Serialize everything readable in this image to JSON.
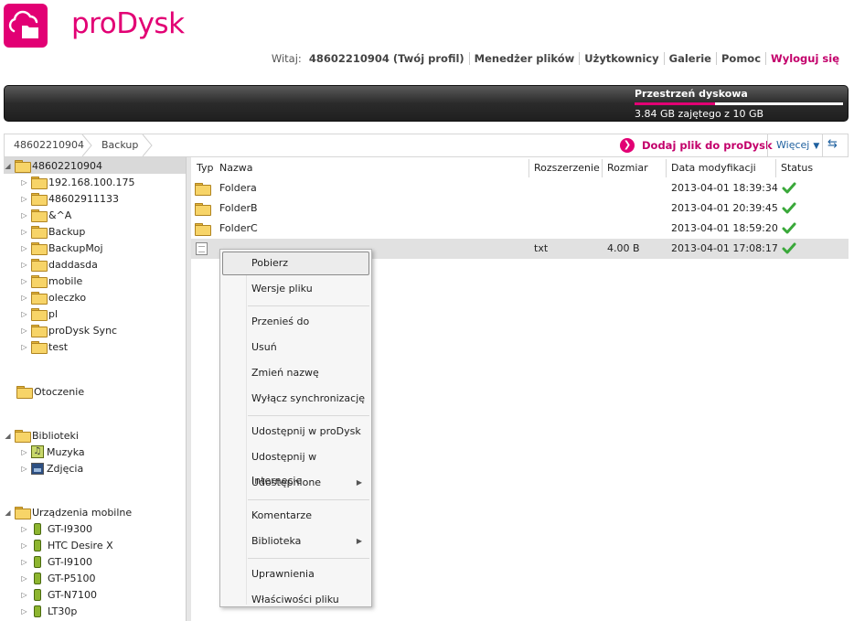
{
  "header": {
    "app_title": "proDysk",
    "welcome_label": "Witaj:",
    "user": "48602210904 (Twój profil)",
    "nav": [
      "Menedżer plików",
      "Użytkownicy",
      "Galerie",
      "Pomoc"
    ],
    "logout": "Wyloguj się"
  },
  "storage": {
    "label": "Przestrzeń dyskowa",
    "usage_text": "3.84 GB zajętego z 10 GB",
    "used_fraction": 0.384
  },
  "breadcrumb": [
    "48602210904",
    "Backup"
  ],
  "toolbar": {
    "add_file": "Dodaj plik do proDysk",
    "more": "Więcej"
  },
  "sidebar": {
    "root": "48602210904",
    "folders": [
      "192.168.100.175",
      "48602911133",
      "&^A",
      "Backup",
      "BackupMoj",
      "daddasda",
      "mobile",
      "oleczko",
      "pl",
      "proDysk Sync",
      "test"
    ],
    "environment": "Otoczenie",
    "libraries": {
      "label": "Biblioteki",
      "items": [
        "Muzyka",
        "Zdjęcia"
      ]
    },
    "mobile": {
      "label": "Urządzenia mobilne",
      "items": [
        "GT-I9300",
        "HTC Desire X",
        "GT-I9100",
        "GT-P5100",
        "GT-N7100",
        "LT30p"
      ]
    }
  },
  "columns": {
    "type": "Typ",
    "name": "Nazwa",
    "ext": "Rozszerzenie",
    "size": "Rozmiar",
    "modified": "Data modyfikacji",
    "status": "Status"
  },
  "files": [
    {
      "name": "Foldera",
      "ext": "",
      "size": "",
      "modified": "2013-04-01 18:39:34"
    },
    {
      "name": "FolderB",
      "ext": "",
      "size": "",
      "modified": "2013-04-01 20:39:45"
    },
    {
      "name": "FolderC",
      "ext": "",
      "size": "",
      "modified": "2013-04-01 18:59:20"
    },
    {
      "name": "",
      "ext": "txt",
      "size": "4.00 B",
      "modified": "2013-04-01 17:08:17"
    }
  ],
  "context_menu": {
    "groups": [
      [
        "Pobierz",
        "Wersje pliku"
      ],
      [
        "Przenieś do",
        "Usuń",
        "Zmień nazwę",
        "Wyłącz synchronizację"
      ],
      [
        "Udostępnij w proDysk",
        "Udostępnij w Internecie",
        "Udostępnione"
      ],
      [
        "Komentarze",
        "Biblioteka"
      ],
      [
        "Uprawnienia",
        "Właściwości pliku"
      ]
    ],
    "hover_item": "Pobierz",
    "submenu_items": [
      "Udostępnione",
      "Biblioteka"
    ]
  },
  "colors": {
    "brand": "#e20074",
    "link": "#1d5f9e",
    "status_ok": "#3aa83a"
  }
}
